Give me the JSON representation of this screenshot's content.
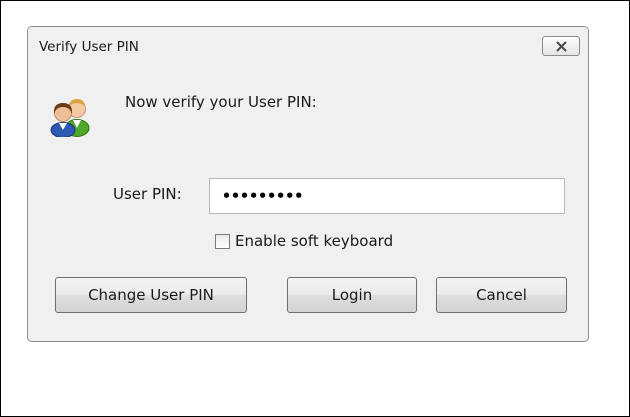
{
  "dialog": {
    "title": "Verify User PIN",
    "close_icon": "close-icon",
    "users_icon": "users-icon",
    "prompt": "Now verify your User PIN:",
    "pin_label": "User PIN:",
    "pin_value": "•••••••••",
    "soft_keyboard_label": "Enable soft keyboard",
    "soft_keyboard_checked": false,
    "buttons": {
      "change_pin": "Change User PIN",
      "login": "Login",
      "cancel": "Cancel"
    }
  },
  "colors": {
    "dialog_background": "#f0f0f0",
    "input_background": "#ffffff",
    "user_left": "#2f57b4",
    "user_right": "#4fa82a",
    "hair_left": "#6b3a1c",
    "hair_right": "#d9a441"
  }
}
